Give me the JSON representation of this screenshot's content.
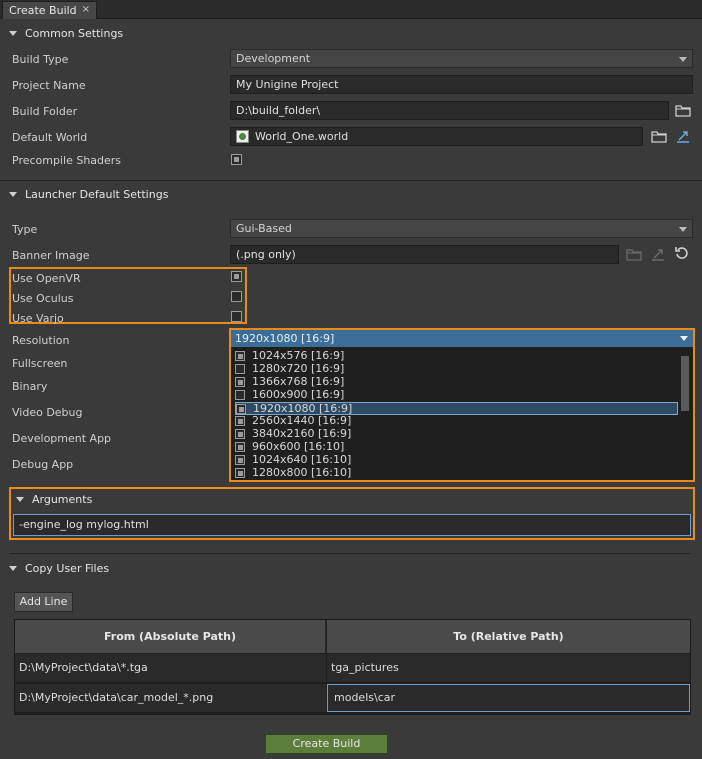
{
  "tab": {
    "title": "Create Build",
    "close": "×"
  },
  "common": {
    "header": "Common Settings",
    "build_type_label": "Build Type",
    "build_type_value": "Development",
    "project_name_label": "Project Name",
    "project_name_value": "My Unigine Project",
    "build_folder_label": "Build Folder",
    "build_folder_value": "D:\\build_folder\\",
    "default_world_label": "Default World",
    "default_world_value": "World_One.world",
    "precompile_label": "Precompile Shaders",
    "precompile_checked": true
  },
  "launcher": {
    "header": "Launcher Default Settings",
    "type_label": "Type",
    "type_value": "Gui-Based",
    "banner_label": "Banner Image",
    "banner_placeholder": "(.png only)",
    "openvr_label": "Use OpenVR",
    "oculus_label": "Use Oculus",
    "varjo_label": "Use Varjo",
    "resolution_label": "Resolution",
    "resolution_value": "1920x1080 [16:9]",
    "fullscreen_label": "Fullscreen",
    "binary_label": "Binary",
    "video_debug_label": "Video Debug",
    "dev_app_label": "Development App",
    "debug_app_label": "Debug App",
    "resolution_options": [
      {
        "label": "1024x576 [16:9]",
        "checked": true
      },
      {
        "label": "1280x720 [16:9]",
        "checked": false
      },
      {
        "label": "1366x768 [16:9]",
        "checked": true
      },
      {
        "label": "1600x900 [16:9]",
        "checked": false
      },
      {
        "label": "1920x1080 [16:9]",
        "checked": true,
        "selected": true
      },
      {
        "label": "2560x1440 [16:9]",
        "checked": true
      },
      {
        "label": "3840x2160 [16:9]",
        "checked": true
      },
      {
        "label": "960x600 [16:10]",
        "checked": true
      },
      {
        "label": "1024x640 [16:10]",
        "checked": true
      },
      {
        "label": "1280x800 [16:10]",
        "checked": true
      }
    ]
  },
  "arguments": {
    "header": "Arguments",
    "value": "-engine_log mylog.html"
  },
  "copy_files": {
    "header": "Copy User Files",
    "add_line": "Add Line",
    "col_from": "From (Absolute Path)",
    "col_to": "To (Relative Path)",
    "rows": [
      {
        "from": "D:\\MyProject\\data\\*.tga",
        "to": "tga_pictures"
      },
      {
        "from": "D:\\MyProject\\data\\car_model_*.png",
        "to": "models\\car"
      }
    ]
  },
  "footer": {
    "create_build": "Create Build"
  },
  "colors": {
    "accent_orange": "#e98a1a",
    "selection_blue": "#3b6d97",
    "create_button_green": "#5b7f3a"
  }
}
